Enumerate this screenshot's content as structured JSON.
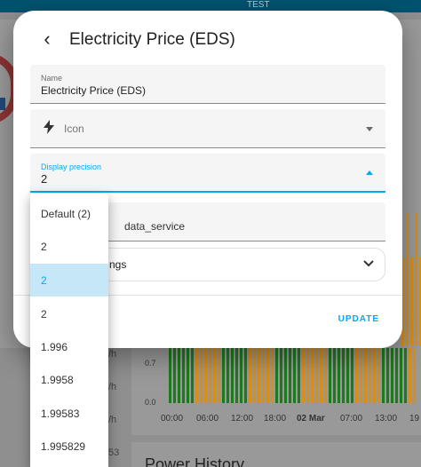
{
  "app": {
    "topbar_label": "TEST"
  },
  "dialog": {
    "title": "Electricity Price (EDS)",
    "name_field": {
      "label": "Name",
      "value": "Electricity Price (EDS)"
    },
    "icon_field": {
      "placeholder": "Icon",
      "icon": "lightning-bolt-icon"
    },
    "precision_field": {
      "label": "Display precision",
      "value": "2"
    },
    "entity_field_visible_value": "data_service",
    "advanced_visible_label": "ngs",
    "update_label": "UPDATE"
  },
  "precision_menu": {
    "items": [
      {
        "label": "Default (2)",
        "selected": false
      },
      {
        "label": "2",
        "selected": false
      },
      {
        "label": "2",
        "selected": true
      },
      {
        "label": "2",
        "selected": false
      },
      {
        "label": "1.996",
        "selected": false
      },
      {
        "label": "1.9958",
        "selected": false
      },
      {
        "label": "1.99583",
        "selected": false
      },
      {
        "label": "1.995829",
        "selected": false
      }
    ]
  },
  "background_chart": {
    "y_ticks": [
      "0.7",
      "0.0"
    ],
    "x_ticks": [
      "00:00",
      "06:00",
      "12:00",
      "18:00",
      "02 Mar",
      "07:00",
      "13:00",
      "19"
    ],
    "side_values": [
      "/h",
      "/h",
      "/h",
      "/h",
      "53"
    ],
    "bottom_card_title": "Power History"
  },
  "colors": {
    "accent": "#03a9f4",
    "bar_green": "#1e7a1e",
    "bar_orange": "#d98e18"
  }
}
